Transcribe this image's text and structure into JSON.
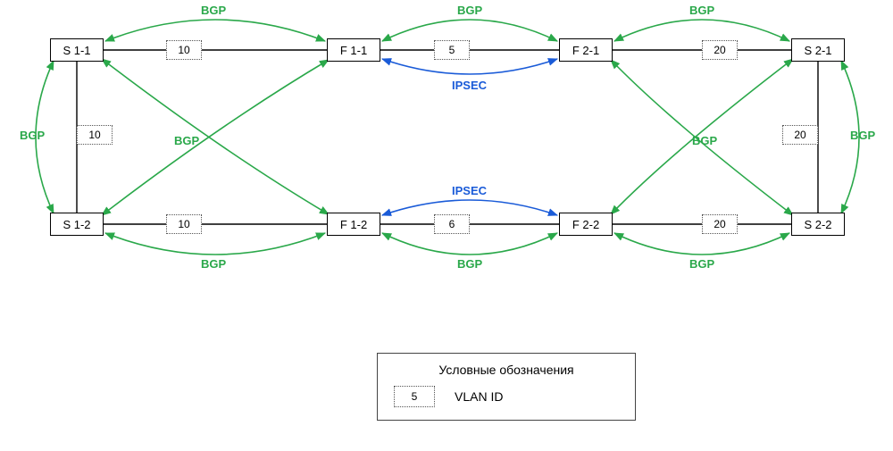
{
  "colors": {
    "bgp": "#2aa84a",
    "ipsec": "#1a5bd8",
    "link": "#000000"
  },
  "nodes": {
    "s11": "S 1-1",
    "f11": "F 1-1",
    "f21": "F 2-1",
    "s21": "S 2-1",
    "s12": "S 1-2",
    "f12": "F 1-2",
    "f22": "F 2-2",
    "s22": "S 2-2"
  },
  "vlans": {
    "s11_f11": "10",
    "f11_f21": "5",
    "f21_s21": "20",
    "s11_s12": "10",
    "s21_s22": "20",
    "s12_f12": "10",
    "f12_f22": "6",
    "f22_s22": "20"
  },
  "labels": {
    "bgp": "BGP",
    "ipsec": "IPSEC"
  },
  "legend": {
    "title": "Условные обозначения",
    "vlan_example": "5",
    "vlan_label": "VLAN ID"
  }
}
